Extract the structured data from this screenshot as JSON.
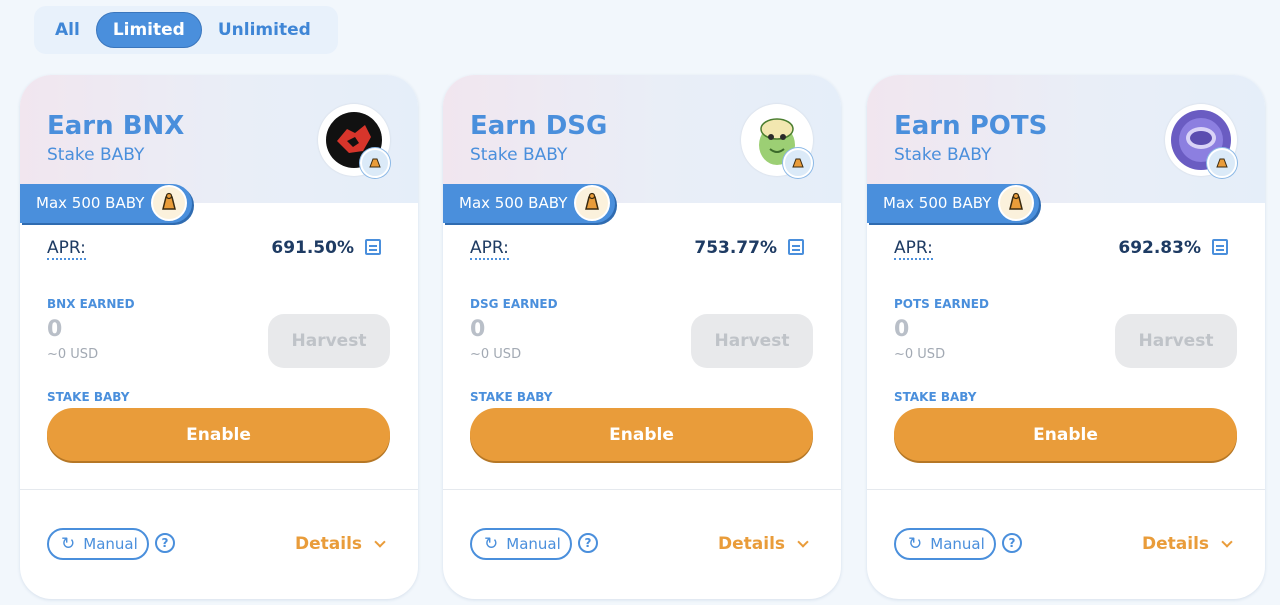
{
  "filters": {
    "all": "All",
    "limited": "Limited",
    "unlimited": "Unlimited",
    "active": "Limited"
  },
  "pools": [
    {
      "title": "Earn BNX",
      "subtitle": "Stake BABY",
      "max": "Max 500 BABY",
      "apr_label": "APR:",
      "apr": "691.50%",
      "earned_label": "BNX EARNED",
      "earned": "0",
      "earned_usd": "~0 USD",
      "harvest": "Harvest",
      "stake_label": "STAKE BABY",
      "enable": "Enable",
      "manual": "Manual",
      "details": "Details",
      "logo_color": "#d7352b"
    },
    {
      "title": "Earn DSG",
      "subtitle": "Stake BABY",
      "max": "Max 500 BABY",
      "apr_label": "APR:",
      "apr": "753.77%",
      "earned_label": "DSG EARNED",
      "earned": "0",
      "earned_usd": "~0 USD",
      "harvest": "Harvest",
      "stake_label": "STAKE BABY",
      "enable": "Enable",
      "manual": "Manual",
      "details": "Details",
      "logo_color": "#8fc46a"
    },
    {
      "title": "Earn POTS",
      "subtitle": "Stake BABY",
      "max": "Max 500 BABY",
      "apr_label": "APR:",
      "apr": "692.83%",
      "earned_label": "POTS EARNED",
      "earned": "0",
      "earned_usd": "~0 USD",
      "harvest": "Harvest",
      "stake_label": "STAKE BABY",
      "enable": "Enable",
      "manual": "Manual",
      "details": "Details",
      "logo_color": "#6a5cc2"
    }
  ],
  "colors": {
    "accent": "#4a8fdc",
    "enable": "#e99c3a",
    "text_dark": "#1e3b63"
  }
}
